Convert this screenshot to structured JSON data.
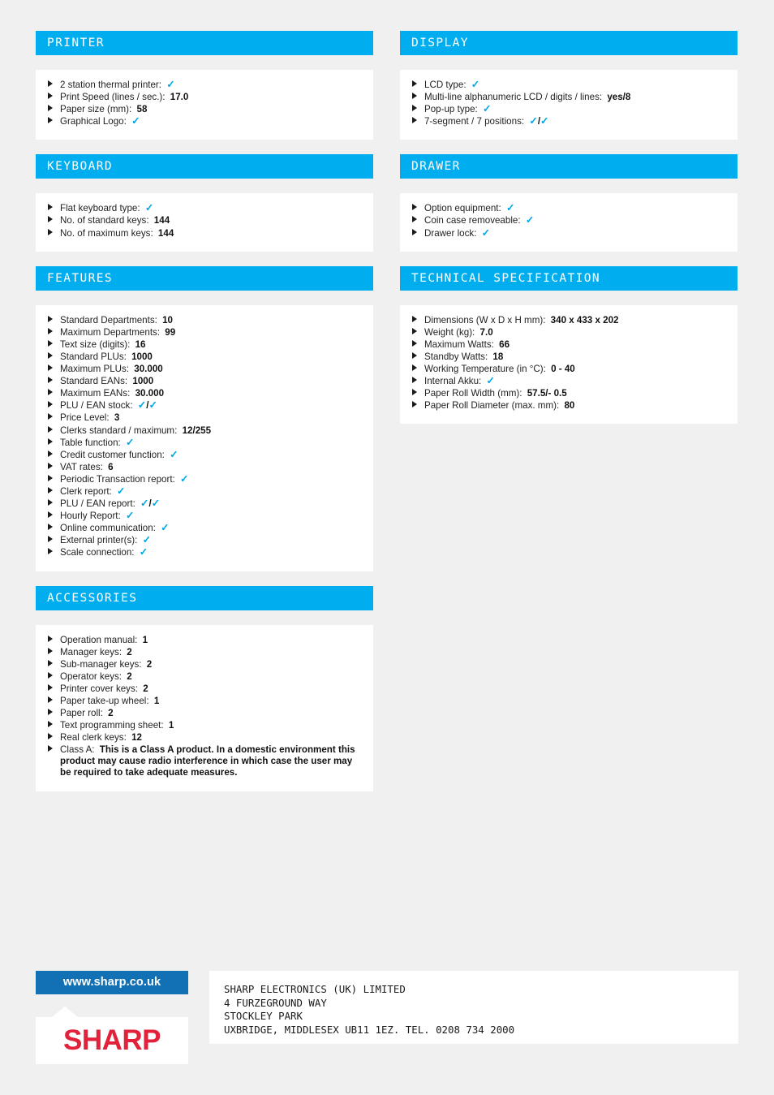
{
  "page": {
    "background_color": "#f0f0f0",
    "accent_color": "#00aeef",
    "badge_color": "#1271b5",
    "logo_color": "#e2213b"
  },
  "sections": {
    "printer": {
      "title": "PRINTER",
      "rows": [
        {
          "label": "2 station thermal printer:",
          "value": "check"
        },
        {
          "label": "Print Speed (lines / sec.):",
          "value": "17.0"
        },
        {
          "label": "Paper size (mm):",
          "value": "58"
        },
        {
          "label": "Graphical Logo:",
          "value": "check"
        }
      ]
    },
    "display": {
      "title": "DISPLAY",
      "rows": [
        {
          "label": "LCD type:",
          "value": "check"
        },
        {
          "label": "Multi-line alphanumeric LCD / digits / lines:",
          "value": "yes/8"
        },
        {
          "label": "Pop-up type:",
          "value": "check"
        },
        {
          "label": "7-segment / 7 positions:",
          "value": "check/check"
        }
      ]
    },
    "keyboard": {
      "title": "KEYBOARD",
      "rows": [
        {
          "label": "Flat keyboard type:",
          "value": "check"
        },
        {
          "label": "No. of standard keys:",
          "value": "144"
        },
        {
          "label": "No. of maximum keys:",
          "value": "144"
        }
      ]
    },
    "drawer": {
      "title": "DRAWER",
      "rows": [
        {
          "label": "Option equipment:",
          "value": "check"
        },
        {
          "label": "Coin case removeable:",
          "value": "check"
        },
        {
          "label": "Drawer lock:",
          "value": "check"
        }
      ]
    },
    "features": {
      "title": "FEATURES",
      "rows": [
        {
          "label": "Standard Departments:",
          "value": "10"
        },
        {
          "label": "Maximum Departments:",
          "value": "99"
        },
        {
          "label": "Text size (digits):",
          "value": "16"
        },
        {
          "label": "Standard PLUs:",
          "value": "1000"
        },
        {
          "label": "Maximum PLUs:",
          "value": "30.000"
        },
        {
          "label": "Standard EANs:",
          "value": "1000"
        },
        {
          "label": "Maximum EANs:",
          "value": "30.000"
        },
        {
          "label": "PLU / EAN stock:",
          "value": "check/check"
        },
        {
          "label": "Price Level:",
          "value": "3"
        },
        {
          "label": "Clerks standard / maximum:",
          "value": "12/255"
        },
        {
          "label": "Table function:",
          "value": "check"
        },
        {
          "label": "Credit customer function:",
          "value": "check"
        },
        {
          "label": "VAT rates:",
          "value": "6"
        },
        {
          "label": "Periodic Transaction report:",
          "value": "check"
        },
        {
          "label": "Clerk report:",
          "value": "check"
        },
        {
          "label": "PLU / EAN report:",
          "value": "check/check"
        },
        {
          "label": "Hourly Report:",
          "value": "check"
        },
        {
          "label": "Online communication:",
          "value": "check"
        },
        {
          "label": "External printer(s):",
          "value": "check"
        },
        {
          "label": "Scale connection:",
          "value": "check"
        }
      ]
    },
    "technical": {
      "title": "TECHNICAL SPECIFICATION",
      "rows": [
        {
          "label": "Dimensions (W x D x H mm):",
          "value": "340 x 433 x 202"
        },
        {
          "label": "Weight (kg):",
          "value": "7.0"
        },
        {
          "label": "Maximum Watts:",
          "value": "66"
        },
        {
          "label": "Standby Watts:",
          "value": "18"
        },
        {
          "label": "Working Temperature (in °C):",
          "value": "0 - 40"
        },
        {
          "label": "Internal Akku:",
          "value": "check"
        },
        {
          "label": "Paper Roll Width (mm):",
          "value": "57.5/- 0.5"
        },
        {
          "label": "Paper Roll Diameter (max. mm):",
          "value": "80"
        }
      ]
    },
    "accessories": {
      "title": "ACCESSORIES",
      "rows": [
        {
          "label": "Operation manual:",
          "value": "1"
        },
        {
          "label": "Manager keys:",
          "value": "2"
        },
        {
          "label": "Sub-manager keys:",
          "value": "2"
        },
        {
          "label": "Operator keys:",
          "value": "2"
        },
        {
          "label": "Printer cover keys:",
          "value": "2"
        },
        {
          "label": "Paper take-up wheel:",
          "value": "1"
        },
        {
          "label": "Paper roll:",
          "value": "2"
        },
        {
          "label": "Text programming sheet:",
          "value": "1"
        },
        {
          "label": "Real clerk keys:",
          "value": "12"
        },
        {
          "label": "Class A:",
          "value": "This is a Class A product. In a domestic environment this product may cause radio interference in which case the user may be required to take adequate measures."
        }
      ]
    }
  },
  "footer": {
    "website": "www.sharp.co.uk",
    "logo": "SHARP",
    "address_lines": [
      "SHARP ELECTRONICS (UK) LIMITED",
      "4 FURZEGROUND WAY",
      "STOCKLEY PARK",
      "UXBRIDGE, MIDDLESEX UB11 1EZ. TEL. 0208 734 2000"
    ]
  }
}
